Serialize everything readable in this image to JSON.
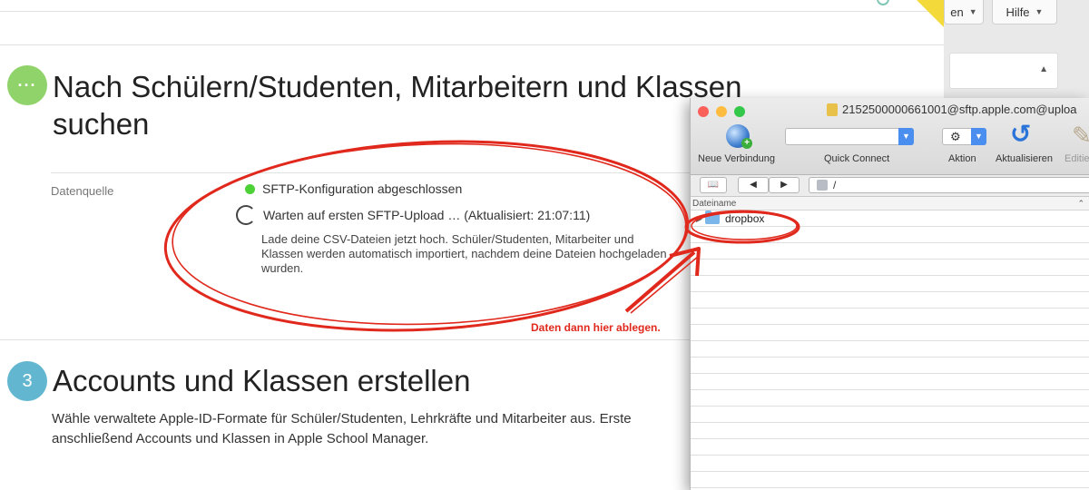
{
  "top_buttons": [
    {
      "label": "en",
      "caret": "▼"
    },
    {
      "label": "Hilfe",
      "caret": "▼"
    }
  ],
  "step_search": {
    "badge": "···",
    "title_line1": "Nach Schülern/Studenten, Mitarbeitern und Klassen",
    "title_line2": "suchen",
    "datasource_label": "Datenquelle",
    "status_ok": "SFTP-Konfiguration abgeschlossen",
    "status_wait": "Warten auf ersten SFTP-Upload … (Aktualisiert: 21:07:11)",
    "description": "Lade deine CSV-Dateien jetzt hoch. Schüler/Studenten, Mitarbeiter und Klassen werden automatisch importiert, nachdem deine Dateien hochgeladen wurden."
  },
  "annotation": "Daten dann hier ablegen.",
  "step_accounts": {
    "badge": "3",
    "title": "Accounts und Klassen erstellen",
    "paragraph_line1": "Wähle verwaltete Apple-ID-Formate für Schüler/Studenten, Lehrkräfte und Mitarbeiter aus. Erste",
    "paragraph_line2": "anschließend Accounts und Klassen in Apple School Manager."
  },
  "sftp_window": {
    "title": "2152500000661001@sftp.apple.com@uploa",
    "toolbar": {
      "new_connection": "Neue Verbindung",
      "quick_connect": "Quick Connect",
      "action": "Aktion",
      "refresh": "Aktualisieren",
      "edit": "Editie"
    },
    "nav": {
      "bookmarks": "📖",
      "back": "◀",
      "forward": "▶",
      "path": "/"
    },
    "column_header": "Dateiname",
    "files": [
      {
        "name": "dropbox",
        "type": "folder"
      }
    ]
  },
  "colors": {
    "annotation_red": "#e0281c",
    "badge_green": "#8fd36a",
    "badge_blue": "#63b6d0",
    "status_green": "#4cd137"
  }
}
